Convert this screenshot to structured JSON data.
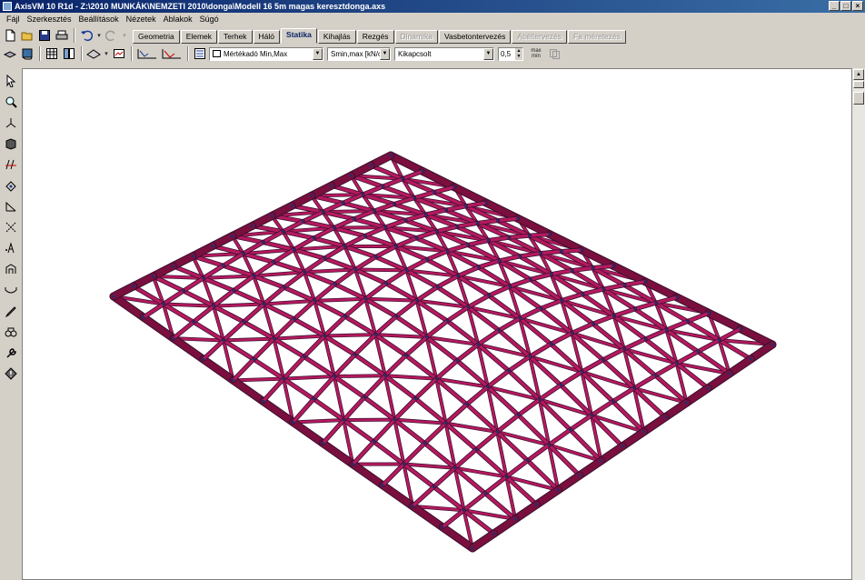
{
  "window": {
    "title": "AxisVM 10 R1d - Z:\\2010 MUNKÁK\\NEMZETI 2010\\donga\\Modell 16 5m magas keresztdonga.axs",
    "controls": [
      "_",
      "□",
      "×"
    ]
  },
  "menu": [
    {
      "label": "Fájl"
    },
    {
      "label": "Szerkesztés"
    },
    {
      "label": "Beállítások"
    },
    {
      "label": "Nézetek"
    },
    {
      "label": "Ablakok"
    },
    {
      "label": "Súgó"
    }
  ],
  "tabs": [
    {
      "label": "Geometria",
      "state": "normal"
    },
    {
      "label": "Elemek",
      "state": "normal"
    },
    {
      "label": "Terhek",
      "state": "normal"
    },
    {
      "label": "Háló",
      "state": "normal"
    },
    {
      "label": "Statika",
      "state": "active"
    },
    {
      "label": "Kihajlás",
      "state": "normal"
    },
    {
      "label": "Rezgés",
      "state": "normal"
    },
    {
      "label": "Dinamika",
      "state": "disabled"
    },
    {
      "label": "Vasbetontervezés",
      "state": "normal"
    },
    {
      "label": "Acéltervezés",
      "state": "disabled"
    },
    {
      "label": "Fa méretezés",
      "state": "disabled"
    }
  ],
  "results_bar": {
    "combination": "Mértékadó Min,Max",
    "component": "Smin,max [kN/cm",
    "display_mode": "Kikapcsolt",
    "scale": "0,5",
    "minmax_label_top": "max",
    "minmax_label_bottom": "min"
  },
  "model": {
    "color_beam": "#b5195e",
    "color_beam_dark": "#7a0f3e",
    "color_edge": "#3a1030",
    "description": "cross-vault lattice shell"
  },
  "colors": {
    "titlebar_start": "#0a246a",
    "titlebar_end": "#3a6ea5",
    "chrome": "#d4d0c8"
  }
}
